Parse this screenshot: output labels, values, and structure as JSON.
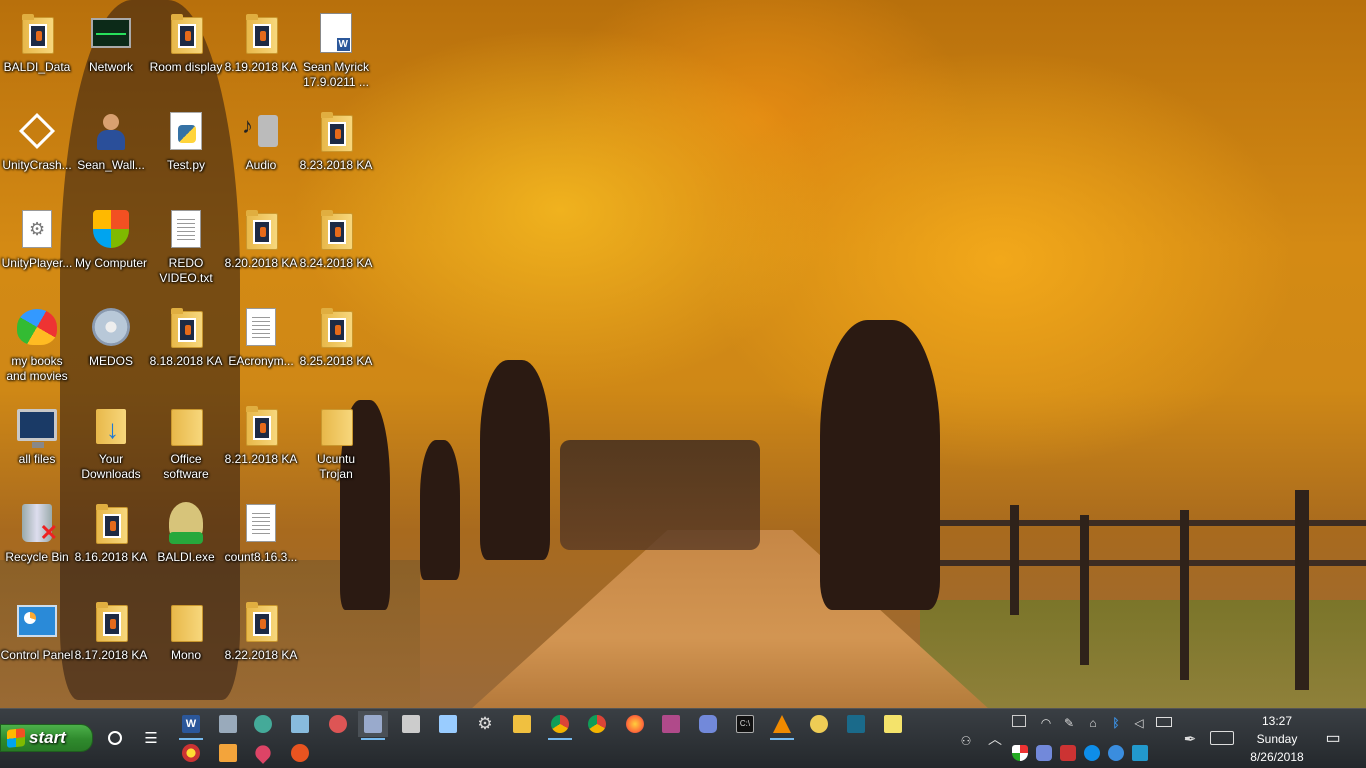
{
  "desktop": {
    "icons": [
      {
        "label": "BALDI_Data",
        "icon": "folder-icon"
      },
      {
        "label": "Network",
        "icon": "network-monitor-icon"
      },
      {
        "label": "Room display",
        "icon": "folder-icon"
      },
      {
        "label": "8.19.2018 KA",
        "icon": "folder-icon"
      },
      {
        "label": "Sean Myrick 17.9.0211 ...",
        "icon": "word-document-icon"
      },
      {
        "label": "UnityCrash...",
        "icon": "unity-icon"
      },
      {
        "label": "Sean_Wall...",
        "icon": "user-icon"
      },
      {
        "label": "Test.py",
        "icon": "python-file-icon"
      },
      {
        "label": "Audio",
        "icon": "speaker-icon"
      },
      {
        "label": "8.23.2018 KA",
        "icon": "folder-icon"
      },
      {
        "label": "UnityPlayer...",
        "icon": "settings-file-icon"
      },
      {
        "label": "My Computer",
        "icon": "shield-icon"
      },
      {
        "label": "REDO VIDEO.txt",
        "icon": "text-file-icon"
      },
      {
        "label": "8.20.2018 KA",
        "icon": "folder-icon"
      },
      {
        "label": "8.24.2018 KA",
        "icon": "folder-icon"
      },
      {
        "label": "my books and movies",
        "icon": "butterfly-icon"
      },
      {
        "label": "MEDOS",
        "icon": "disc-icon"
      },
      {
        "label": "8.18.2018 KA",
        "icon": "folder-icon"
      },
      {
        "label": "EAcronym...",
        "icon": "text-file-icon"
      },
      {
        "label": "8.25.2018 KA",
        "icon": "folder-icon"
      },
      {
        "label": "all files",
        "icon": "computer-icon"
      },
      {
        "label": "Your Downloads",
        "icon": "downloads-folder-icon"
      },
      {
        "label": "Office software",
        "icon": "plain-folder-icon"
      },
      {
        "label": "8.21.2018 KA",
        "icon": "folder-icon"
      },
      {
        "label": "Ucuntu Trojan",
        "icon": "plain-folder-icon"
      },
      {
        "label": "Recycle Bin",
        "icon": "recycle-bin-icon"
      },
      {
        "label": "8.16.2018 KA",
        "icon": "folder-icon"
      },
      {
        "label": "BALDI.exe",
        "icon": "baldi-icon"
      },
      {
        "label": "count8.16.3...",
        "icon": "text-file-icon"
      },
      {
        "label": "Control Panel",
        "icon": "control-panel-icon"
      },
      {
        "label": "8.17.2018 KA",
        "icon": "folder-icon"
      },
      {
        "label": "Mono",
        "icon": "plain-folder-icon"
      },
      {
        "label": "8.22.2018 KA",
        "icon": "folder-icon"
      }
    ]
  },
  "taskbar": {
    "start_label": "start",
    "pinned": [
      {
        "icon": "cortana-circle-icon",
        "color": "#ffffff"
      },
      {
        "icon": "task-view-icon",
        "color": "#ffffff"
      },
      {
        "icon": "word-icon",
        "color": "#2b579a"
      },
      {
        "icon": "app-icon",
        "color": "#9ab"
      },
      {
        "icon": "paint-icon",
        "color": "#4a9"
      },
      {
        "icon": "notepad-icon",
        "color": "#8bd"
      },
      {
        "icon": "paint-brush-icon",
        "color": "#d55"
      },
      {
        "icon": "photo-viewer-icon",
        "color": "#9ac"
      },
      {
        "icon": "calculator-icon",
        "color": "#ccc"
      },
      {
        "icon": "notes-icon",
        "color": "#9cf"
      },
      {
        "icon": "settings-icon",
        "color": "#ddd"
      },
      {
        "icon": "file-explorer-icon",
        "color": "#f0c040"
      },
      {
        "icon": "google-chrome-icon",
        "color": "#4285f4"
      },
      {
        "icon": "chrome-icon",
        "color": "#db4437"
      },
      {
        "icon": "firefox-icon",
        "color": "#ff7139"
      },
      {
        "icon": "winrar-icon",
        "color": "#b04a8a"
      },
      {
        "icon": "discord-icon",
        "color": "#7289da"
      },
      {
        "icon": "command-prompt-icon",
        "color": "#111"
      },
      {
        "icon": "vlc-icon",
        "color": "#f08a00"
      },
      {
        "icon": "app-icon-2",
        "color": "#ec5"
      },
      {
        "icon": "book-icon",
        "color": "#1a6a8a"
      },
      {
        "icon": "sticky-notes-icon",
        "color": "#f4e36b"
      }
    ],
    "row2": [
      {
        "icon": "app-icon-3",
        "color": "#c33"
      },
      {
        "icon": "media-player-icon",
        "color": "#f3a43b"
      },
      {
        "icon": "map-pin-icon",
        "color": "#d46"
      },
      {
        "icon": "ubuntu-icon",
        "color": "#e95420"
      }
    ],
    "tray_top": [
      "network-drive-icon",
      "wifi-icon",
      "pen-icon",
      "lock-icon",
      "bluetooth-icon",
      "volume-icon",
      "battery-icon"
    ],
    "tray_bottom": [
      "defender-icon",
      "discord-tray-icon",
      "app-tray-icon",
      "teamviewer-icon",
      "cloud-icon",
      "display-icon"
    ],
    "clock": {
      "time": "13:27",
      "day": "Sunday",
      "date": "8/26/2018"
    },
    "notification_icon": "action-center-icon"
  }
}
